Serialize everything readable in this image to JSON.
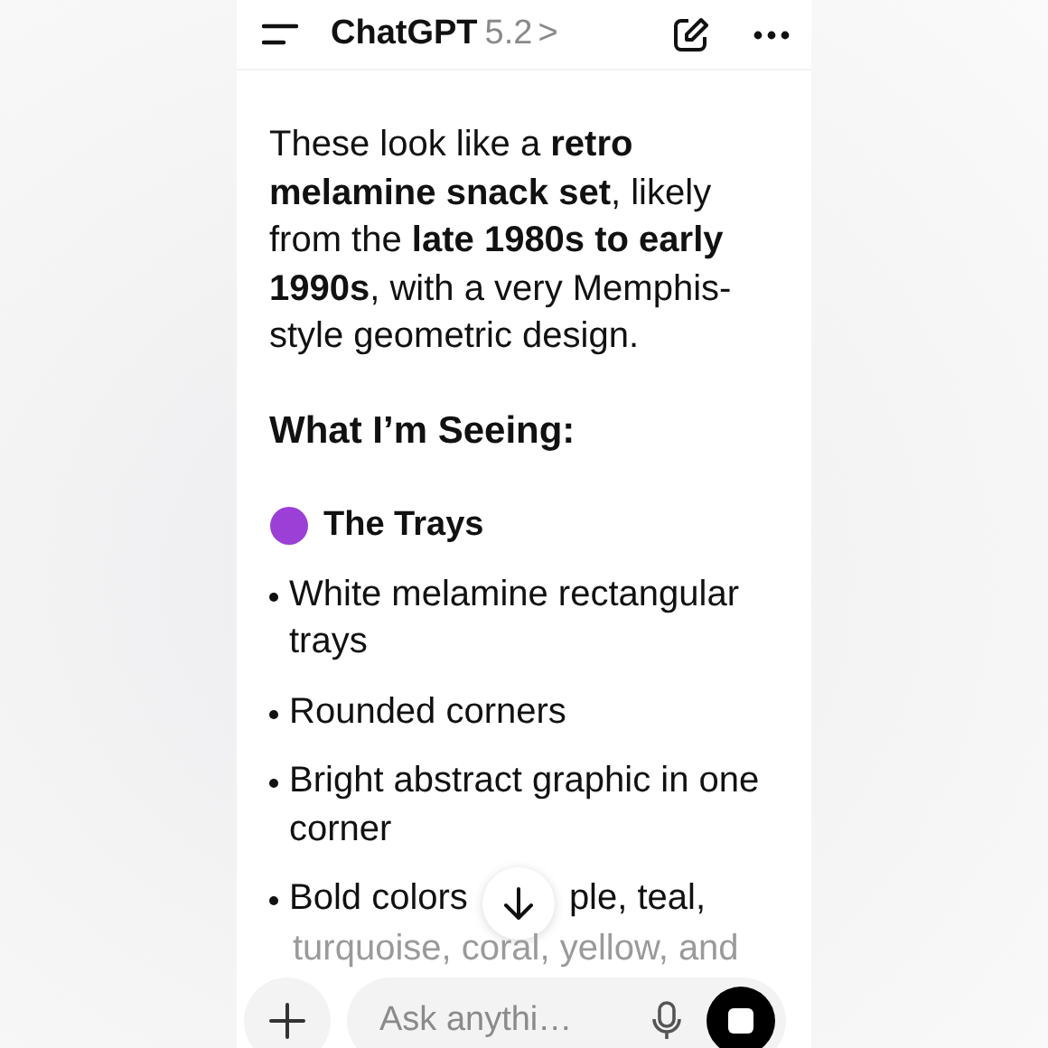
{
  "header": {
    "title": "ChatGPT",
    "version": "5.2",
    "chevron": ">"
  },
  "message": {
    "intro": "These look like a **retro melamine snack set**, likely from the **late 1980s to early 1990s**, with a very Memphis-style geometric design.",
    "heading": "What I’m Seeing:",
    "section": {
      "title": "The Trays",
      "bullets": [
        "White melamine rectangular trays",
        "Rounded corners",
        "Bright abstract graphic in one corner"
      ],
      "covered_bullet": {
        "before": "Bold colors",
        "after": "ple, teal,"
      },
      "cut_line": "turquoise, coral, yellow, and"
    }
  },
  "composer": {
    "placeholder": "Ask anythi…"
  }
}
